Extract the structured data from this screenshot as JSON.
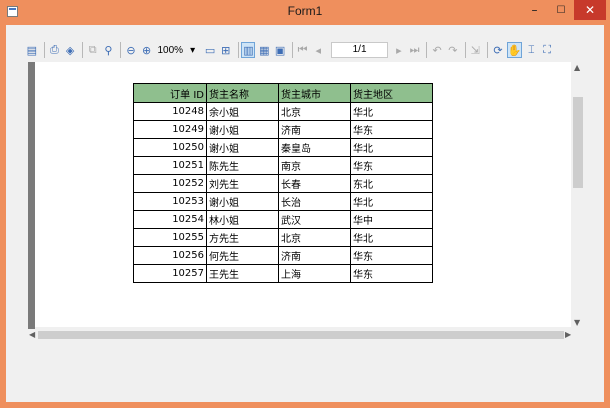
{
  "window": {
    "title": "Form1",
    "minimize_glyph": "–",
    "maximize_glyph": "☐",
    "close_glyph": "✕",
    "app_icon": "form-icon"
  },
  "toolbar": {
    "zoom_value": "100%",
    "zoom_arrow": "▾",
    "page_indicator": "1/1",
    "icons": [
      "document-map-icon",
      "print-icon",
      "page-setup-icon",
      "copy-icon",
      "find-icon",
      "zoom-out-icon",
      "zoom-in-icon",
      "single-page-icon",
      "multi-page-icon",
      "page-layout-icon",
      "continuous-icon",
      "first-page-icon",
      "prev-page-icon",
      "next-page-icon",
      "last-page-icon",
      "back-icon",
      "forward-icon",
      "export-icon",
      "refresh-icon",
      "hand-icon",
      "select-icon",
      "full-screen-icon"
    ]
  },
  "table": {
    "columns": [
      "订单 ID",
      "货主名称",
      "货主城市",
      "货主地区"
    ],
    "rows": [
      [
        "10248",
        "余小姐",
        "北京",
        "华北"
      ],
      [
        "10249",
        "谢小姐",
        "济南",
        "华东"
      ],
      [
        "10250",
        "谢小姐",
        "秦皇岛",
        "华北"
      ],
      [
        "10251",
        "陈先生",
        "南京",
        "华东"
      ],
      [
        "10252",
        "刘先生",
        "长春",
        "东北"
      ],
      [
        "10253",
        "谢小姐",
        "长治",
        "华北"
      ],
      [
        "10254",
        "林小姐",
        "武汉",
        "华中"
      ],
      [
        "10255",
        "方先生",
        "北京",
        "华北"
      ],
      [
        "10256",
        "何先生",
        "济南",
        "华东"
      ],
      [
        "10257",
        "王先生",
        "上海",
        "华东"
      ]
    ],
    "header_color": "#8fbf8e"
  },
  "colors": {
    "frame": "#ef8f5d",
    "close_button": "#c7392b",
    "accent": "#3d6db5"
  }
}
